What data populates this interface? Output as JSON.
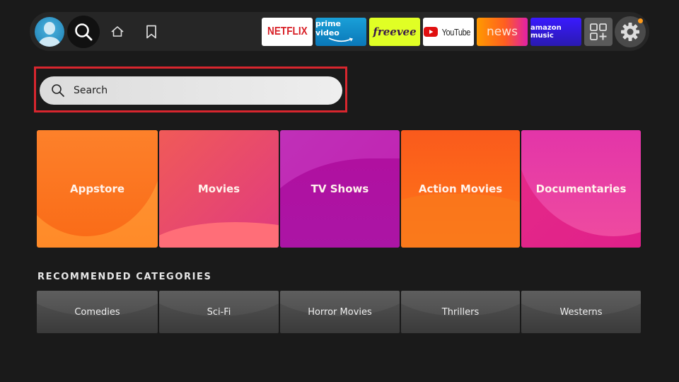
{
  "nav": {
    "profile_icon": "user-profile-icon",
    "search_icon": "search-icon",
    "home_icon": "home-icon",
    "watchlist_icon": "bookmark-icon",
    "apps": [
      {
        "name": "netflix",
        "label": "NETFLIX",
        "bg": "#ffffff",
        "fg": "#d81f26"
      },
      {
        "name": "prime-video",
        "label": "prime video",
        "bg": "#0f8cc8",
        "fg": "#ffffff"
      },
      {
        "name": "freevee",
        "label": "freevee",
        "bg": "#e0ff25",
        "fg": "#3b1a4a"
      },
      {
        "name": "youtube",
        "label": "YouTube",
        "bg": "#ffffff",
        "fg": "#222222"
      },
      {
        "name": "news",
        "label": "news",
        "bg": "#ff6a10",
        "fg": "#ffe6d6"
      },
      {
        "name": "amazon-music",
        "label": "amazon music",
        "bg": "#2f1ae0",
        "fg": "#ffffff"
      }
    ],
    "all_apps_icon": "apps-grid-icon",
    "settings_icon": "gear-icon",
    "notification_color": "#ff9a1a"
  },
  "search": {
    "placeholder": "Search",
    "highlight_color": "#d8262e"
  },
  "categories": [
    {
      "label": "Appstore",
      "color": "#ff8a2a"
    },
    {
      "label": "Movies",
      "color": "#e8486a"
    },
    {
      "label": "TV Shows",
      "color": "#b012a8"
    },
    {
      "label": "Action Movies",
      "color": "#ff6a18"
    },
    {
      "label": "Documentaries",
      "color": "#e02a9a"
    }
  ],
  "recommended": {
    "title": "RECOMMENDED CATEGORIES",
    "items": [
      {
        "label": "Comedies"
      },
      {
        "label": "Sci-Fi"
      },
      {
        "label": "Horror Movies"
      },
      {
        "label": "Thrillers"
      },
      {
        "label": "Westerns"
      }
    ]
  }
}
